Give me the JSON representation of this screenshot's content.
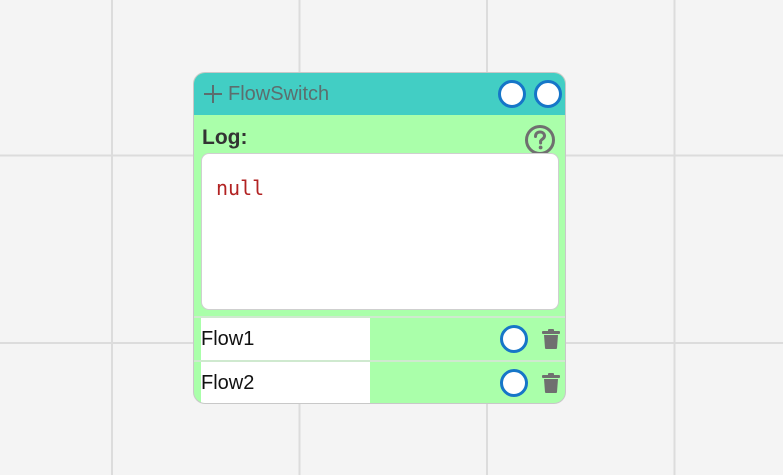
{
  "node": {
    "title": "FlowSwitch",
    "header_color": "#42cec4",
    "body_color": "#aaffaa",
    "port_color": "#1676c8"
  },
  "log": {
    "label": "Log:",
    "value": "null"
  },
  "flows": [
    {
      "name": "Flow1"
    },
    {
      "name": "Flow2"
    }
  ],
  "icons": {
    "add": "plus-icon",
    "help": "question-circle-icon",
    "delete": "trash-icon"
  }
}
